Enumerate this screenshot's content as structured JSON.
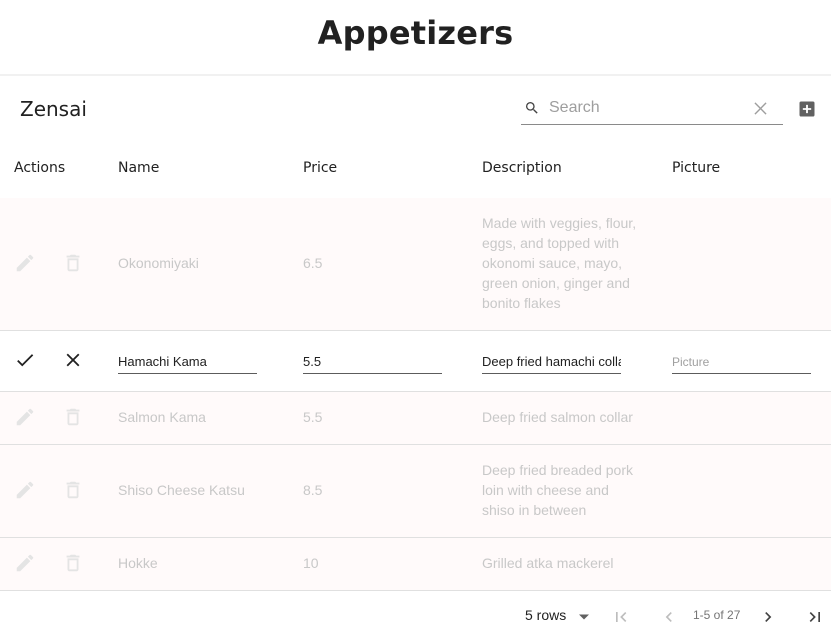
{
  "page": {
    "title": "Appetizers"
  },
  "table": {
    "title": "Zensai",
    "search_placeholder": "Search",
    "search_value": "",
    "columns": [
      "Actions",
      "Name",
      "Price",
      "Description",
      "Picture"
    ],
    "rows": [
      {
        "name": "Okonomiyaki",
        "price": "6.5",
        "desc_lines": [
          "Made with veggies, flour,",
          "eggs, and topped with",
          "okonomi sauce, mayo,",
          "green onion, ginger and",
          "bonito flakes"
        ]
      },
      {
        "editing": true,
        "name": "Hamachi Kama",
        "price": "5.5",
        "description": "Deep fried hamachi collar",
        "picture_placeholder": "Picture"
      },
      {
        "name": "Salmon Kama",
        "price": "5.5",
        "desc_lines": [
          "Deep fried salmon collar"
        ]
      },
      {
        "name": "Shiso Cheese Katsu",
        "price": "8.5",
        "desc_lines": [
          "Deep fried breaded pork",
          "loin with cheese and",
          "shiso in between"
        ]
      },
      {
        "name": "Hokke",
        "price": "10",
        "desc_lines": [
          "Grilled atka mackerel"
        ]
      }
    ]
  },
  "pagination": {
    "rows_per_page": "5 rows",
    "range": "1-5 of 27"
  },
  "icons": {
    "search": "search-icon",
    "clear": "close-icon",
    "add": "add-box-icon",
    "edit": "pencil-icon",
    "delete": "trash-icon",
    "confirm": "check-icon",
    "cancel": "close-icon",
    "first_page": "first-page-icon",
    "prev_page": "chevron-left-icon",
    "next_page": "chevron-right-icon",
    "last_page": "last-page-icon"
  }
}
